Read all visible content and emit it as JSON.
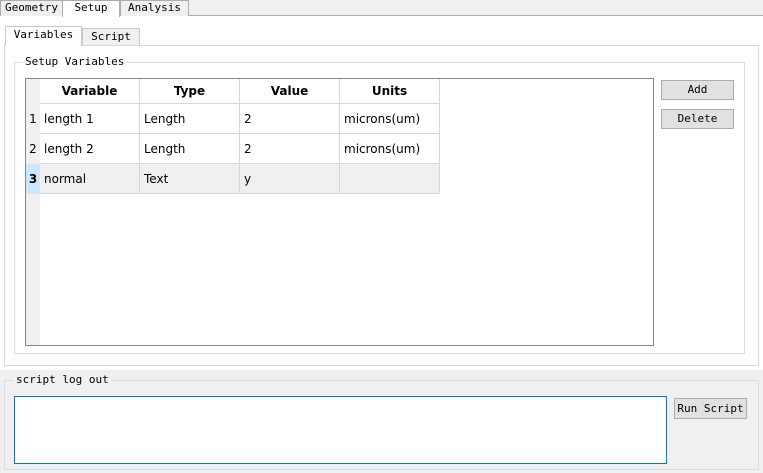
{
  "top_tabs": [
    {
      "label": "Geometry"
    },
    {
      "label": "Setup"
    },
    {
      "label": "Analysis"
    }
  ],
  "inner_tabs": [
    {
      "label": "Variables"
    },
    {
      "label": "Script"
    }
  ],
  "setup_group": {
    "title": "Setup Variables"
  },
  "table": {
    "headers": [
      "Variable",
      "Type",
      "Value",
      "Units"
    ],
    "rows": [
      {
        "num": "1",
        "variable": "length 1",
        "type": "Length",
        "value": "2",
        "units": "microns(um)"
      },
      {
        "num": "2",
        "variable": "length 2",
        "type": "Length",
        "value": "2",
        "units": "microns(um)"
      },
      {
        "num": "3",
        "variable": "normal",
        "type": "Text",
        "value": "y",
        "units": ""
      }
    ]
  },
  "buttons": {
    "add": "Add",
    "delete": "Delete",
    "run_script": "Run Script"
  },
  "log_group": {
    "title": "script log out",
    "text": ""
  }
}
